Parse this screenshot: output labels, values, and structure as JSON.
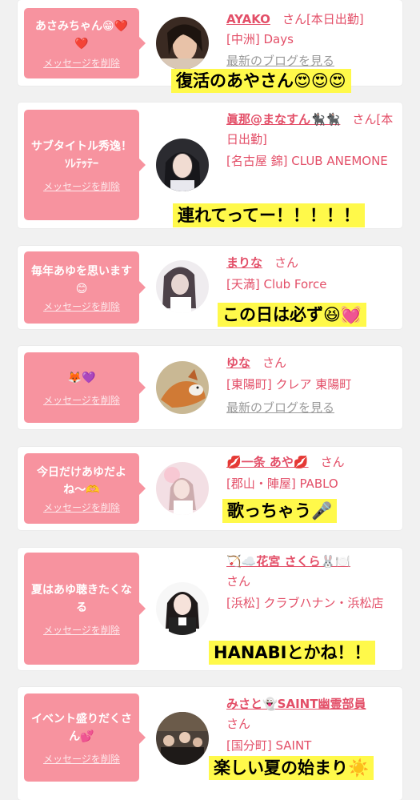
{
  "cards": [
    {
      "message": "あさみちゃん😁❤️❤️",
      "delete_label": "メッセージを削除",
      "user": "AYAKO",
      "suffix": "さん",
      "status": "[本日出勤]",
      "shop": "[中洲] Days",
      "blog": "最新のブログを見る",
      "note": "復活のあやさん😍😍😍"
    },
    {
      "message": "サブタイトル秀逸！ｿﾚﾃｯﾃｰ",
      "delete_label": "メッセージを削除",
      "user": "眞那@まなすん🐈‍⬛🐈‍⬛",
      "suffix": "さん",
      "status": "[本日出勤]",
      "shop": "[名古屋 錦] CLUB ANEMONE",
      "note": "連れてってー！！！！！"
    },
    {
      "message": "毎年あゆを思います😊",
      "delete_label": "メッセージを削除",
      "user": "まりな",
      "suffix": "さん",
      "shop": "[天満] Club Force",
      "note": "この日は必ず😆💓"
    },
    {
      "message": "🦊💜",
      "delete_label": "メッセージを削除",
      "user": "ゆな",
      "suffix": "さん",
      "shop": "[東陽町] クレア 東陽町",
      "blog": "最新のブログを見る"
    },
    {
      "message": "今日だけあゆだよね〜🫶",
      "delete_label": "メッセージを削除",
      "user": "💋一条 あや💋",
      "suffix": "さん",
      "shop": "[郡山・陣屋] PABLO",
      "note": "歌っちゃう🎤"
    },
    {
      "message": "夏はあゆ聴きたくなる",
      "delete_label": "メッセージを削除",
      "user": "🏹☁️花宮 さくら🐰🍽️",
      "suffix": "さん",
      "shop": "[浜松] クラブハナン・浜松店",
      "note": "HANABIとかね！！"
    },
    {
      "message": "イベント盛りだくさん💕",
      "delete_label": "メッセージを削除",
      "user": "みさと👻SAINT幽霊部員",
      "suffix": "さん",
      "shop": "[国分町] SAINT",
      "note": "楽しい夏の始まり☀️"
    }
  ],
  "colors": {
    "bubble": "#f7939f",
    "name": "#e34f68",
    "highlight": "#fff94a",
    "background": "#f1f1f1"
  },
  "icons": [
    "avatar-photo"
  ]
}
